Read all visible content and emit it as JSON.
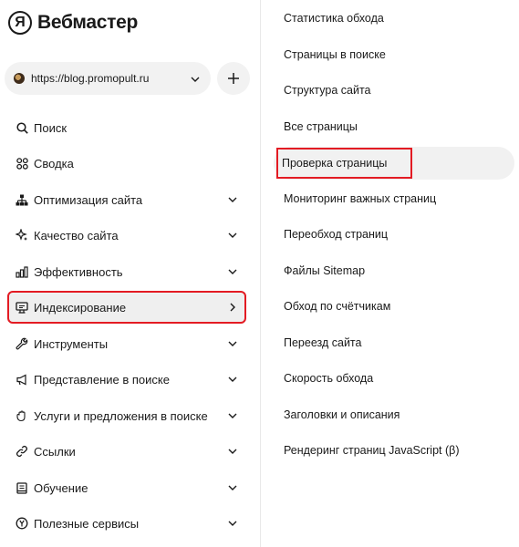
{
  "app": {
    "logo_glyph": "Я",
    "title": "Вебмастер"
  },
  "site_selector": {
    "url": "https://blog.promopult.ru",
    "add_label": "+"
  },
  "sidebar": {
    "items": [
      {
        "label": "Поиск",
        "icon": "search-icon",
        "has_arrow": false
      },
      {
        "label": "Сводка",
        "icon": "dashboard-icon",
        "has_arrow": false
      },
      {
        "label": "Оптимизация сайта",
        "icon": "sitemap-icon",
        "has_arrow": "down"
      },
      {
        "label": "Качество сайта",
        "icon": "sparkle-icon",
        "has_arrow": "down"
      },
      {
        "label": "Эффективность",
        "icon": "bar-chart-icon",
        "has_arrow": "down"
      },
      {
        "label": "Индексирование",
        "icon": "monitor-icon",
        "has_arrow": "right",
        "active": true
      },
      {
        "label": "Инструменты",
        "icon": "wrench-icon",
        "has_arrow": "down"
      },
      {
        "label": "Представление в поиске",
        "icon": "megaphone-icon",
        "has_arrow": "down"
      },
      {
        "label": "Услуги и предложения в поиске",
        "icon": "hand-icon",
        "has_arrow": "down"
      },
      {
        "label": "Ссылки",
        "icon": "link-icon",
        "has_arrow": "down"
      },
      {
        "label": "Обучение",
        "icon": "book-icon",
        "has_arrow": "down"
      },
      {
        "label": "Полезные сервисы",
        "icon": "yandex-circle-icon",
        "has_arrow": "down"
      }
    ]
  },
  "submenu": {
    "items": [
      {
        "label": "Статистика обхода"
      },
      {
        "label": "Страницы в поиске"
      },
      {
        "label": "Структура сайта"
      },
      {
        "label": "Все страницы"
      },
      {
        "label": "Проверка страницы",
        "highlighted": true
      },
      {
        "label": "Мониторинг важных страниц"
      },
      {
        "label": "Переобход страниц"
      },
      {
        "label": "Файлы Sitemap"
      },
      {
        "label": "Обход по счётчикам"
      },
      {
        "label": "Переезд сайта"
      },
      {
        "label": "Скорость обхода"
      },
      {
        "label": "Заголовки и описания"
      },
      {
        "label": "Рендеринг страниц JavaScript (β)"
      }
    ]
  },
  "colors": {
    "highlight_border": "#e31b23",
    "active_bg": "#efefef",
    "pill_bg": "#f2f2f2"
  }
}
